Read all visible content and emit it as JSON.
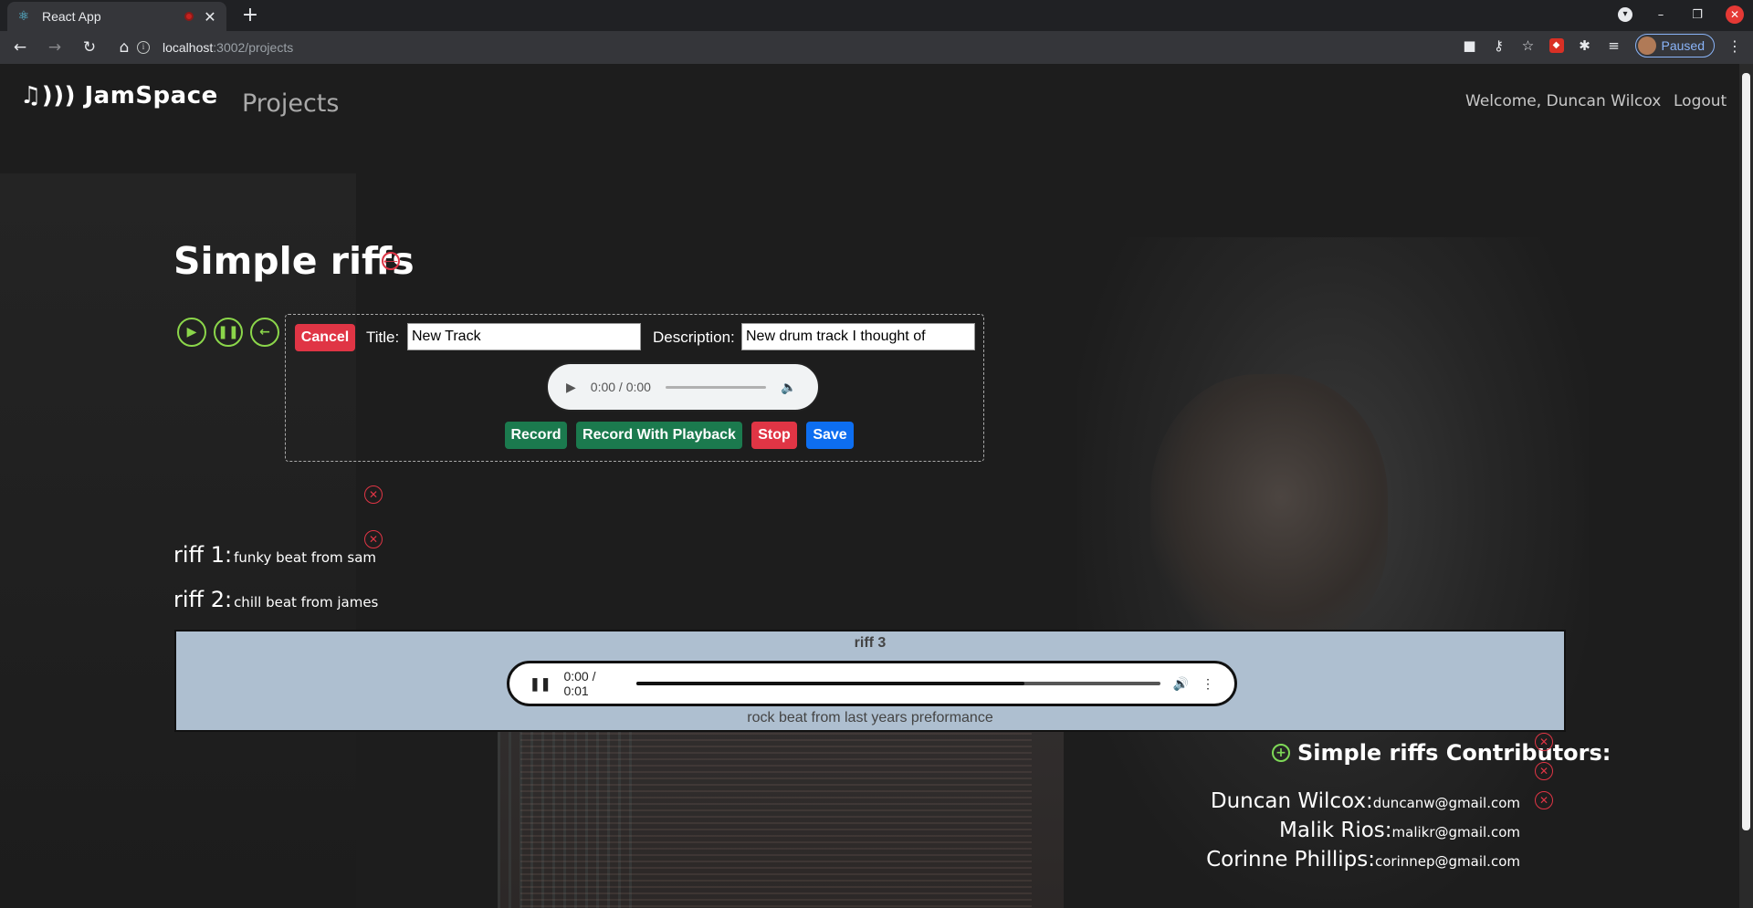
{
  "browser": {
    "tab_title": "React App",
    "url_host": "localhost",
    "url_path": ":3002/projects",
    "profile_label": "Paused"
  },
  "app": {
    "brand": "♫))) JamSpace",
    "nav_projects": "Projects",
    "welcome": "Welcome, Duncan Wilcox",
    "logout": "Logout"
  },
  "project": {
    "title": "Simple riffs"
  },
  "new_track": {
    "cancel": "Cancel",
    "title_label": "Title:",
    "title_value": "New Track",
    "desc_label": "Description:",
    "desc_value": "New drum track I thought of",
    "audio_time": "0:00 / 0:00",
    "record": "Record",
    "record_with_playback": "Record With Playback",
    "stop": "Stop",
    "save": "Save"
  },
  "riffs": [
    {
      "label": "riff 1:",
      "desc": "funky beat from sam"
    },
    {
      "label": "riff 2:",
      "desc": "chill beat from james"
    }
  ],
  "active_riff": {
    "title": "riff 3",
    "time": "0:00 / 0:01",
    "progress": 0.74,
    "desc": "rock beat from last years preformance"
  },
  "contributors": {
    "heading": "Simple riffs Contributors:",
    "people": [
      {
        "name": "Duncan Wilcox:",
        "email": "duncanw@gmail.com"
      },
      {
        "name": "Malik Rios:",
        "email": "malikr@gmail.com"
      },
      {
        "name": "Corinne Phillips:",
        "email": "corinnep@gmail.com"
      }
    ]
  },
  "colors": {
    "accent_green": "#8bd64a",
    "danger_red": "#e03545",
    "record_green": "#1b7a4e",
    "save_blue": "#0d6ef0",
    "active_riff_bg": "#aebfd0"
  }
}
